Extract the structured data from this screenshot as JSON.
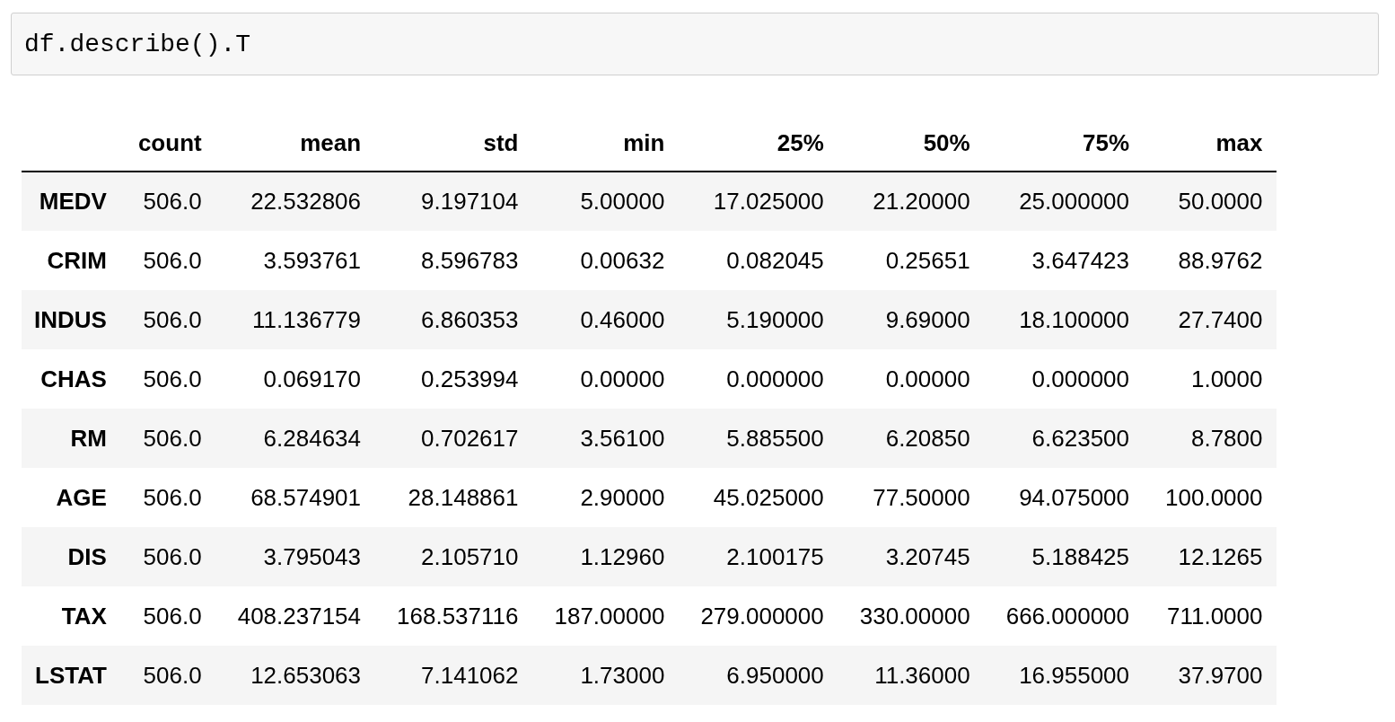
{
  "code_cell": {
    "code": "df.describe().T"
  },
  "table": {
    "columns": [
      "count",
      "mean",
      "std",
      "min",
      "25%",
      "50%",
      "75%",
      "max"
    ],
    "rows": [
      {
        "index": "MEDV",
        "cells": [
          "506.0",
          "22.532806",
          "9.197104",
          "5.00000",
          "17.025000",
          "21.20000",
          "25.000000",
          "50.0000"
        ]
      },
      {
        "index": "CRIM",
        "cells": [
          "506.0",
          "3.593761",
          "8.596783",
          "0.00632",
          "0.082045",
          "0.25651",
          "3.647423",
          "88.9762"
        ]
      },
      {
        "index": "INDUS",
        "cells": [
          "506.0",
          "11.136779",
          "6.860353",
          "0.46000",
          "5.190000",
          "9.69000",
          "18.100000",
          "27.7400"
        ]
      },
      {
        "index": "CHAS",
        "cells": [
          "506.0",
          "0.069170",
          "0.253994",
          "0.00000",
          "0.000000",
          "0.00000",
          "0.000000",
          "1.0000"
        ]
      },
      {
        "index": "RM",
        "cells": [
          "506.0",
          "6.284634",
          "0.702617",
          "3.56100",
          "5.885500",
          "6.20850",
          "6.623500",
          "8.7800"
        ]
      },
      {
        "index": "AGE",
        "cells": [
          "506.0",
          "68.574901",
          "28.148861",
          "2.90000",
          "45.025000",
          "77.50000",
          "94.075000",
          "100.0000"
        ]
      },
      {
        "index": "DIS",
        "cells": [
          "506.0",
          "3.795043",
          "2.105710",
          "1.12960",
          "2.100175",
          "3.20745",
          "5.188425",
          "12.1265"
        ]
      },
      {
        "index": "TAX",
        "cells": [
          "506.0",
          "408.237154",
          "168.537116",
          "187.00000",
          "279.000000",
          "330.00000",
          "666.000000",
          "711.0000"
        ]
      },
      {
        "index": "LSTAT",
        "cells": [
          "506.0",
          "12.653063",
          "7.141062",
          "1.73000",
          "6.950000",
          "11.36000",
          "16.955000",
          "37.9700"
        ]
      }
    ]
  }
}
